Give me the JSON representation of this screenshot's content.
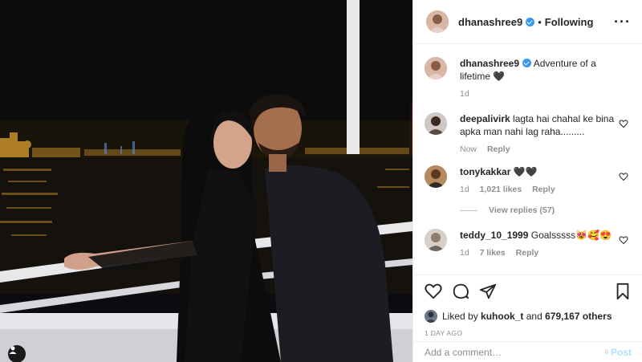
{
  "post": {
    "author": "dhanashree9",
    "follow_status": "Following",
    "separator": "•",
    "more_icon": "more-options-icon"
  },
  "caption": {
    "username": "dhanashree9",
    "text": "Adventure of a lifetime",
    "emoji": "🖤",
    "time": "1d"
  },
  "comments": [
    {
      "username": "deepalivirk",
      "text": "lagta hai chahal ke bina apka man nahi lag raha.........",
      "time": "Now",
      "likes": "",
      "reply": "Reply"
    },
    {
      "username": "tonykakkar",
      "text": "🖤🖤",
      "time": "1d",
      "likes": "1,021 likes",
      "reply": "Reply",
      "view_replies": "View replies (57)"
    },
    {
      "username": "teddy_10_1999",
      "text": "Goalsssss😻🥰😍",
      "time": "1d",
      "likes": "7 likes",
      "reply": "Reply"
    }
  ],
  "likes": {
    "prefix": "Liked by",
    "user": "kuhook_t",
    "middle": "and",
    "count": "679,167 others"
  },
  "timestamp": "1 DAY AGO",
  "add_comment": {
    "placeholder": "Add a comment…",
    "post_label": "Post"
  },
  "colors": {
    "highlight": "#ff3a3a",
    "verified": "#3897f0",
    "post_disabled": "#b2dffc",
    "muted": "#8e8e8e"
  }
}
